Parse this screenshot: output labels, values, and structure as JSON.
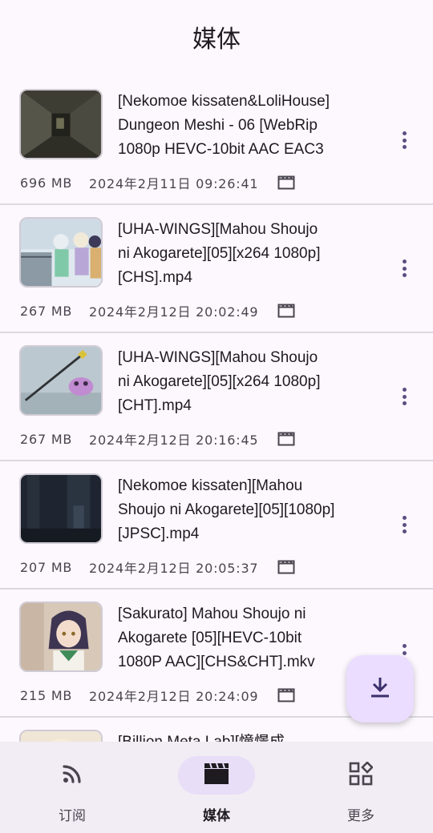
{
  "header": {
    "title": "媒体"
  },
  "media": [
    {
      "title": "[Nekomoe kissaten&LoliHouse]\nDungeon Meshi - 06 [WebRip\n1080p HEVC-10bit AAC EAC3",
      "size": "696 MB",
      "date": "2024年2月11日 09:26:41"
    },
    {
      "title": "[UHA-WINGS][Mahou Shoujo\nni Akogarete][05][x264 1080p]\n[CHS].mp4",
      "size": "267 MB",
      "date": "2024年2月12日 20:02:49"
    },
    {
      "title": "[UHA-WINGS][Mahou Shoujo\nni Akogarete][05][x264 1080p]\n[CHT].mp4",
      "size": "267 MB",
      "date": "2024年2月12日 20:16:45"
    },
    {
      "title": "[Nekomoe kissaten][Mahou\nShoujo ni Akogarete][05][1080p]\n[JPSC].mp4",
      "size": "207 MB",
      "date": "2024年2月12日 20:05:37"
    },
    {
      "title": "[Sakurato] Mahou Shoujo ni\nAkogarete [05][HEVC-10bit\n1080P AAC][CHS&CHT].mkv",
      "size": "215 MB",
      "date": "2024年2月12日 20:24:09"
    },
    {
      "title": "[Billion Meta Lab][憧憬成",
      "size": "",
      "date": ""
    }
  ],
  "fab": {
    "icon": "download-icon"
  },
  "nav": [
    {
      "label": "订阅",
      "icon": "rss-feed-icon",
      "active": false
    },
    {
      "label": "媒体",
      "icon": "clapperboard-icon",
      "active": true
    },
    {
      "label": "更多",
      "icon": "grid-apps-icon",
      "active": false
    }
  ],
  "colors": {
    "background": "#fdf7fe",
    "accent": "#5a4f82",
    "fab": "#eaddff",
    "nav_active": "#e8def8"
  }
}
